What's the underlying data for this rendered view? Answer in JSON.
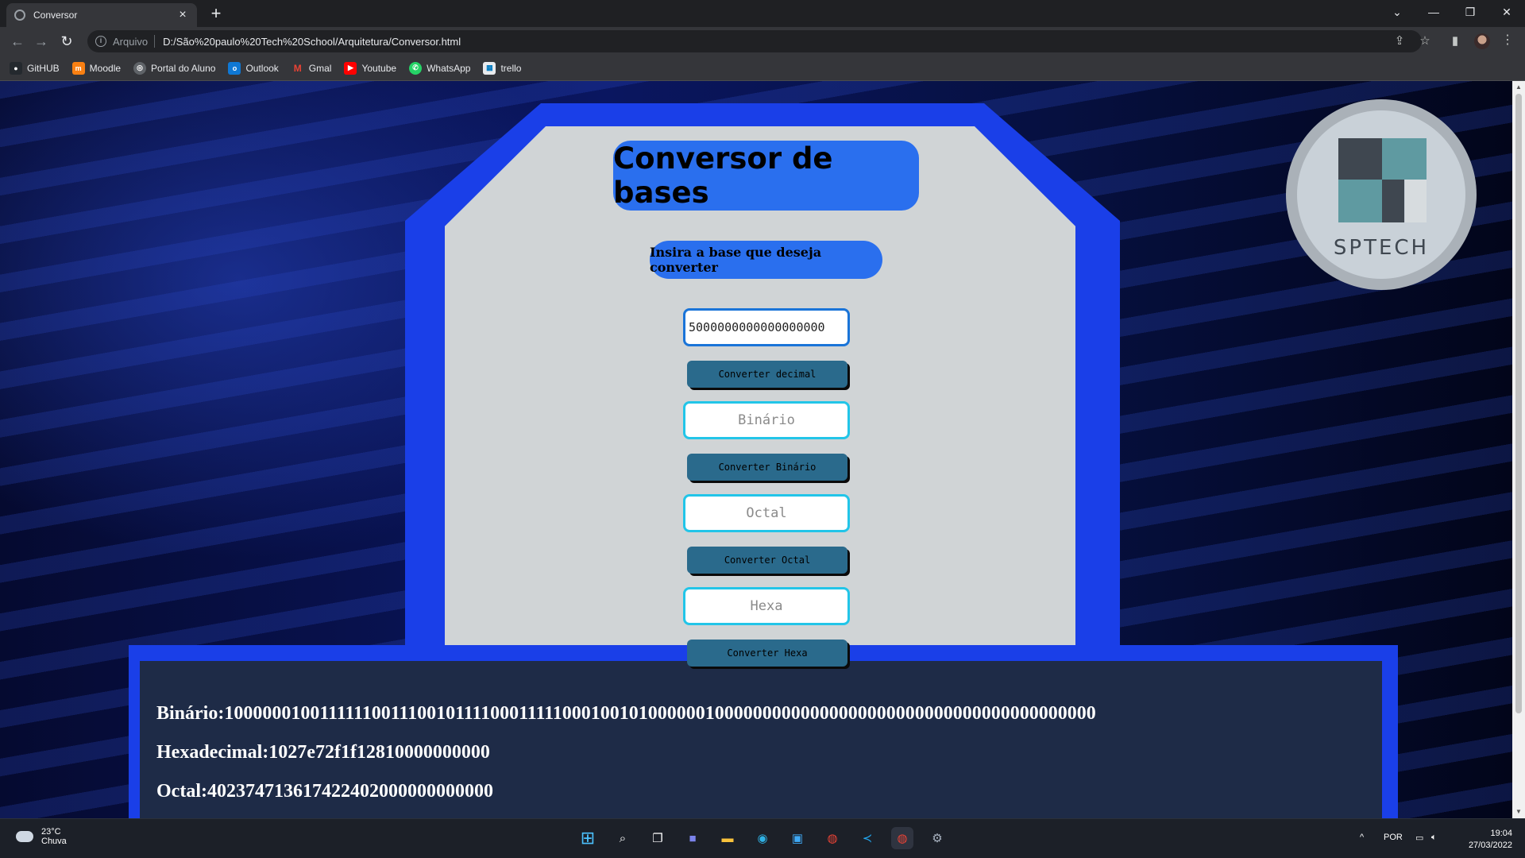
{
  "browser": {
    "tab_title": "Conversor",
    "url_scheme": "Arquivo",
    "url": "D:/São%20paulo%20Tech%20School/Arquitetura/Conversor.html",
    "bookmarks": [
      {
        "label": "GitHUB",
        "icon": "github-icon",
        "color": "#ffffff"
      },
      {
        "label": "Moodle",
        "icon": "moodle-icon",
        "color": "#f98012"
      },
      {
        "label": "Portal do Aluno",
        "icon": "portal-icon",
        "color": "#e8eaed"
      },
      {
        "label": "Outlook",
        "icon": "outlook-icon",
        "color": "#0f78d4"
      },
      {
        "label": "Gmal",
        "icon": "gmail-icon",
        "color": "#ea4335"
      },
      {
        "label": "Youtube",
        "icon": "youtube-icon",
        "color": "#ff0000"
      },
      {
        "label": "WhatsApp",
        "icon": "whatsapp-icon",
        "color": "#25d366"
      },
      {
        "label": "trello",
        "icon": "trello-icon",
        "color": "#ffffff"
      }
    ]
  },
  "page": {
    "title": "Conversor de bases",
    "subtitle": "Insira a base que deseja converter",
    "decimal_input_value": "5000000000000000000",
    "binary_placeholder": "Binário",
    "octal_placeholder": "Octal",
    "hexa_placeholder": "Hexa",
    "btn_decimal": "Converter decimal",
    "btn_binary": "Converter Binário",
    "btn_octal": "Converter Octal",
    "btn_hexa": "Converter Hexa",
    "result_binary": "Binário:100000010011111100111001011110001111100010010100000010000000000000000000000000000000000000000",
    "result_hexa": "Hexadecimal:1027e72f1f12810000000000",
    "result_octal": "Octal:402374713617422402000000000000",
    "logo_text": "SPTECH",
    "colors": {
      "frame": "#1a3fe8",
      "pill": "#2a6fee",
      "panel": "#d0d4d6",
      "output": "#1e2b47",
      "button": "#2a6a8c"
    }
  },
  "taskbar": {
    "weather_temp": "23°C",
    "weather_desc": "Chuva",
    "language": "POR",
    "time": "19:04",
    "date": "27/03/2022"
  }
}
